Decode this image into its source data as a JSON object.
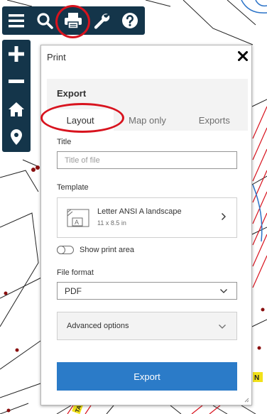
{
  "toolbar": {
    "items": [
      {
        "name": "menu-icon"
      },
      {
        "name": "search-icon"
      },
      {
        "name": "print-icon"
      },
      {
        "name": "wrench-icon"
      },
      {
        "name": "help-icon"
      }
    ],
    "background": "#14354a"
  },
  "navbar": {
    "items": [
      {
        "name": "zoom-in-icon"
      },
      {
        "name": "zoom-out-icon"
      },
      {
        "name": "home-icon"
      },
      {
        "name": "locate-icon"
      }
    ]
  },
  "annotation_color": "#d8131e",
  "print_panel": {
    "title": "Print",
    "close_icon": "close-icon",
    "export_heading": "Export",
    "tabs": [
      {
        "label": "Layout",
        "active": true
      },
      {
        "label": "Map only",
        "active": false
      },
      {
        "label": "Exports",
        "active": false
      }
    ],
    "title_field": {
      "label": "Title",
      "placeholder": "Title of file",
      "value": ""
    },
    "template": {
      "label": "Template",
      "name": "Letter ANSI A landscape",
      "size": "11 x 8.5 in",
      "icon": "layout-page-icon"
    },
    "show_print_area": {
      "label": "Show print area",
      "checked": false
    },
    "file_format": {
      "label": "File format",
      "value": "PDF"
    },
    "advanced_options": {
      "label": "Advanced options",
      "expanded": false
    },
    "export_button": {
      "label": "Export",
      "color": "#2b7bc8"
    }
  },
  "map_labels": {
    "label_a": "N",
    "label_b": "TA"
  }
}
